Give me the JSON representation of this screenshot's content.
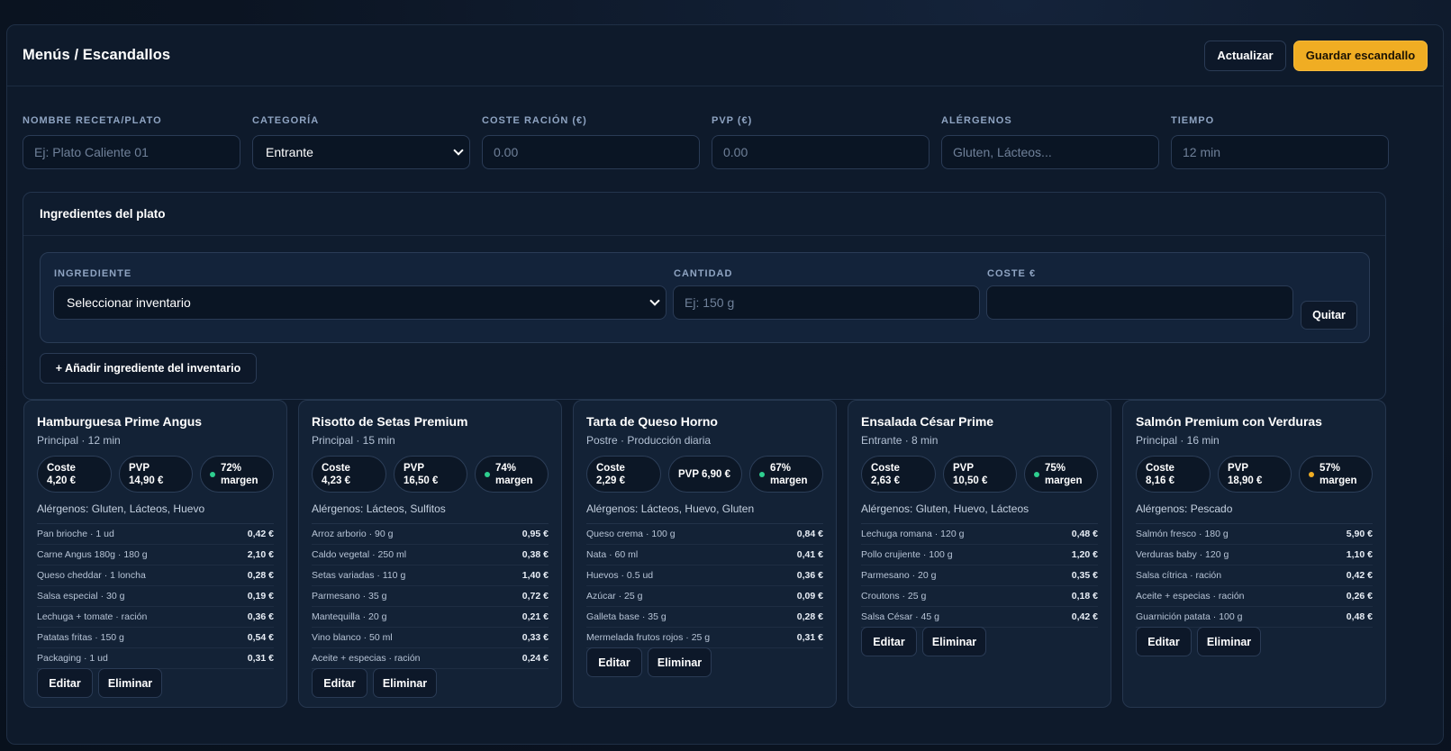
{
  "header": {
    "title": "Menús / Escandallos",
    "refresh_label": "Actualizar",
    "save_label": "Guardar escandallo"
  },
  "form": {
    "name": {
      "label": "NOMBRE RECETA/PLATO",
      "placeholder": "Ej: Plato Caliente 01"
    },
    "category": {
      "label": "CATEGORÍA",
      "value": "Entrante"
    },
    "cost": {
      "label": "COSTE RACIÓN (€)",
      "placeholder": "0.00"
    },
    "pvp": {
      "label": "PVP (€)",
      "placeholder": "0.00"
    },
    "allergens": {
      "label": "ALÉRGENOS",
      "placeholder": "Gluten, Lácteos..."
    },
    "time": {
      "label": "TIEMPO",
      "placeholder": "12 min"
    }
  },
  "ingredients_panel": {
    "title": "Ingredientes del plato",
    "ingredient_label": "INGREDIENTE",
    "ingredient_value": "Seleccionar inventario",
    "quantity_label": "CANTIDAD",
    "quantity_placeholder": "Ej: 150 g",
    "cost_label": "COSTE €",
    "remove_label": "Quitar",
    "add_label": "+ Añadir ingrediente del inventario"
  },
  "card_labels": {
    "edit": "Editar",
    "delete": "Eliminar"
  },
  "colors": {
    "margin_good": "#2ecf8f",
    "margin_warn": "#f0ad23",
    "accent": "#f0ad23"
  },
  "cards": [
    {
      "name": "Hamburguesa Prime Angus",
      "meta": "Principal · 12 min",
      "cost_l1": "Coste",
      "cost_l2": "4,20 €",
      "pvp_l1": "PVP",
      "pvp_l2": "14,90 €",
      "margin_l1": "72%",
      "margin_l2": "margen",
      "margin_status": "good",
      "allergens": "Alérgenos: Gluten, Lácteos, Huevo",
      "ingredients": [
        {
          "name": "Pan brioche · 1 ud",
          "cost": "0,42 €"
        },
        {
          "name": "Carne Angus 180g · 180 g",
          "cost": "2,10 €"
        },
        {
          "name": "Queso cheddar · 1 loncha",
          "cost": "0,28 €"
        },
        {
          "name": "Salsa especial · 30 g",
          "cost": "0,19 €"
        },
        {
          "name": "Lechuga + tomate · ración",
          "cost": "0,36 €"
        },
        {
          "name": "Patatas fritas · 150 g",
          "cost": "0,54 €"
        },
        {
          "name": "Packaging · 1 ud",
          "cost": "0,31 €"
        }
      ]
    },
    {
      "name": "Risotto de Setas Premium",
      "meta": "Principal · 15 min",
      "cost_l1": "Coste",
      "cost_l2": "4,23 €",
      "pvp_l1": "PVP",
      "pvp_l2": "16,50 €",
      "margin_l1": "74%",
      "margin_l2": "margen",
      "margin_status": "good",
      "allergens": "Alérgenos: Lácteos, Sulfitos",
      "ingredients": [
        {
          "name": "Arroz arborio · 90 g",
          "cost": "0,95 €"
        },
        {
          "name": "Caldo vegetal · 250 ml",
          "cost": "0,38 €"
        },
        {
          "name": "Setas variadas · 110 g",
          "cost": "1,40 €"
        },
        {
          "name": "Parmesano · 35 g",
          "cost": "0,72 €"
        },
        {
          "name": "Mantequilla · 20 g",
          "cost": "0,21 €"
        },
        {
          "name": "Vino blanco · 50 ml",
          "cost": "0,33 €"
        },
        {
          "name": "Aceite + especias · ración",
          "cost": "0,24 €"
        }
      ]
    },
    {
      "name": "Tarta de Queso Horno",
      "meta": "Postre · Producción diaria",
      "cost_l1": "Coste",
      "cost_l2": "2,29 €",
      "pvp_l1": "PVP 6,90 €",
      "pvp_l2": "",
      "margin_l1": "67%",
      "margin_l2": "margen",
      "margin_status": "good",
      "allergens": "Alérgenos: Lácteos, Huevo, Gluten",
      "ingredients": [
        {
          "name": "Queso crema · 100 g",
          "cost": "0,84 €"
        },
        {
          "name": "Nata · 60 ml",
          "cost": "0,41 €"
        },
        {
          "name": "Huevos · 0.5 ud",
          "cost": "0,36 €"
        },
        {
          "name": "Azúcar · 25 g",
          "cost": "0,09 €"
        },
        {
          "name": "Galleta base · 35 g",
          "cost": "0,28 €"
        },
        {
          "name": "Mermelada frutos rojos · 25 g",
          "cost": "0,31 €"
        }
      ]
    },
    {
      "name": "Ensalada César Prime",
      "meta": "Entrante · 8 min",
      "cost_l1": "Coste",
      "cost_l2": "2,63 €",
      "pvp_l1": "PVP",
      "pvp_l2": "10,50 €",
      "margin_l1": "75%",
      "margin_l2": "margen",
      "margin_status": "good",
      "allergens": "Alérgenos: Gluten, Huevo, Lácteos",
      "ingredients": [
        {
          "name": "Lechuga romana · 120 g",
          "cost": "0,48 €"
        },
        {
          "name": "Pollo crujiente · 100 g",
          "cost": "1,20 €"
        },
        {
          "name": "Parmesano · 20 g",
          "cost": "0,35 €"
        },
        {
          "name": "Croutons · 25 g",
          "cost": "0,18 €"
        },
        {
          "name": "Salsa César · 45 g",
          "cost": "0,42 €"
        }
      ]
    },
    {
      "name": "Salmón Premium con Verduras",
      "meta": "Principal · 16 min",
      "cost_l1": "Coste",
      "cost_l2": "8,16 €",
      "pvp_l1": "PVP",
      "pvp_l2": "18,90 €",
      "margin_l1": "57%",
      "margin_l2": "margen",
      "margin_status": "warn",
      "allergens": "Alérgenos: Pescado",
      "ingredients": [
        {
          "name": "Salmón fresco · 180 g",
          "cost": "5,90 €"
        },
        {
          "name": "Verduras baby · 120 g",
          "cost": "1,10 €"
        },
        {
          "name": "Salsa cítrica · ración",
          "cost": "0,42 €"
        },
        {
          "name": "Aceite + especias · ración",
          "cost": "0,26 €"
        },
        {
          "name": "Guarnición patata · 100 g",
          "cost": "0,48 €"
        }
      ]
    }
  ]
}
